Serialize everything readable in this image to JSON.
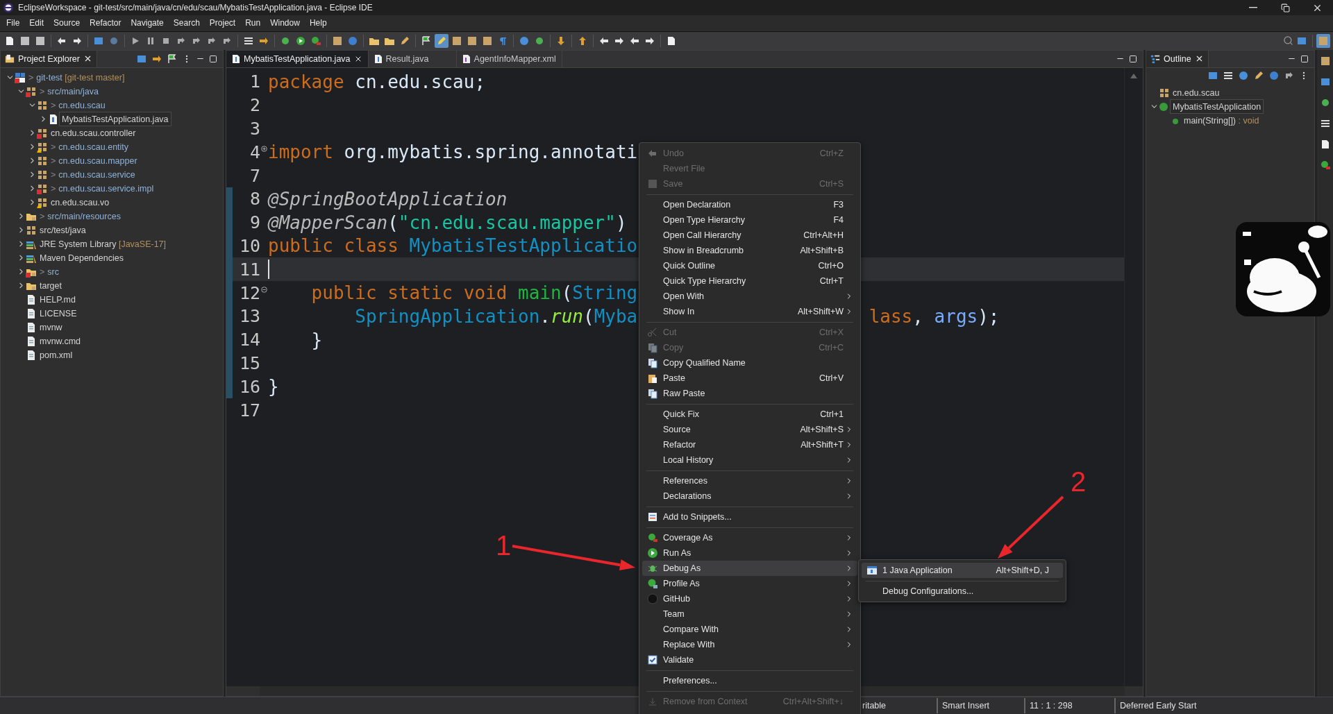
{
  "window": {
    "title": "EclipseWorkspace - git-test/src/main/java/cn/edu/scau/MybatisTestApplication.java - Eclipse IDE"
  },
  "menu_bar": [
    "File",
    "Edit",
    "Source",
    "Refactor",
    "Navigate",
    "Search",
    "Project",
    "Run",
    "Window",
    "Help"
  ],
  "project_explorer": {
    "title": "Project Explorer",
    "tree": [
      {
        "kind": "project",
        "marker": ">",
        "label": "git-test",
        "suffix": "[git-test master]",
        "error": true,
        "expanded": true,
        "selected": false,
        "children": [
          {
            "kind": "source-folder",
            "marker": ">",
            "label": "src/main/java",
            "error": true,
            "expanded": true,
            "selected": false,
            "children": [
              {
                "kind": "package",
                "marker": ">",
                "label": "cn.edu.scau",
                "expanded": true,
                "selected": false,
                "children": [
                  {
                    "kind": "java-file",
                    "label": "MybatisTestApplication.java",
                    "expanded": false,
                    "selected": true
                  }
                ]
              },
              {
                "kind": "package",
                "label": "cn.edu.scau.controller",
                "error": true,
                "expanded": false,
                "selected": false
              },
              {
                "kind": "package",
                "marker": ">",
                "label": "cn.edu.scau.entity",
                "warning": true,
                "expanded": false,
                "selected": false
              },
              {
                "kind": "package",
                "marker": ">",
                "label": "cn.edu.scau.mapper",
                "expanded": false,
                "selected": false
              },
              {
                "kind": "package",
                "marker": ">",
                "label": "cn.edu.scau.service",
                "expanded": false,
                "selected": false
              },
              {
                "kind": "package",
                "marker": ">",
                "label": "cn.edu.scau.service.impl",
                "error": true,
                "expanded": false,
                "selected": false
              },
              {
                "kind": "package",
                "label": "cn.edu.scau.vo",
                "warning": true,
                "expanded": false,
                "selected": false
              }
            ]
          },
          {
            "kind": "resource-folder",
            "marker": ">",
            "label": "src/main/resources",
            "expanded": false,
            "selected": false
          },
          {
            "kind": "source-folder",
            "label": "src/test/java",
            "expanded": false,
            "selected": false
          },
          {
            "kind": "library",
            "label": "JRE System Library",
            "suffix": "[JavaSE-17]",
            "expanded": false,
            "selected": false
          },
          {
            "kind": "library",
            "label": "Maven Dependencies",
            "expanded": false,
            "selected": false
          },
          {
            "kind": "folder",
            "marker": ">",
            "label": "src",
            "error": true,
            "expanded": false,
            "selected": false
          },
          {
            "kind": "folder",
            "label": "target",
            "expanded": false,
            "selected": false
          },
          {
            "kind": "file",
            "label": "HELP.md",
            "selected": false
          },
          {
            "kind": "file",
            "label": "LICENSE",
            "selected": false
          },
          {
            "kind": "file",
            "label": "mvnw",
            "selected": false
          },
          {
            "kind": "file",
            "label": "mvnw.cmd",
            "selected": false
          },
          {
            "kind": "file",
            "label": "pom.xml",
            "selected": false
          }
        ]
      }
    ]
  },
  "editor": {
    "tabs": [
      {
        "kind": "java",
        "label": "MybatisTestApplication.java",
        "selected": true
      },
      {
        "kind": "java",
        "label": "Result.java",
        "selected": false
      },
      {
        "kind": "xml",
        "label": "AgentInfoMapper.xml",
        "selected": false
      }
    ],
    "lines": [
      {
        "n": "1",
        "current": false,
        "changed": false,
        "tokens": [
          {
            "kind": "keyword",
            "t": "package"
          },
          {
            "kind": "plain",
            "t": " cn.edu.scau;"
          }
        ]
      },
      {
        "n": "2",
        "current": false,
        "changed": false
      },
      {
        "n": "3",
        "current": false,
        "changed": false
      },
      {
        "n": "4",
        "current": false,
        "changed": false,
        "folded": true,
        "tokens": [
          {
            "kind": "keyword",
            "t": "import"
          },
          {
            "kind": "plain",
            "t": " org.mybatis.spring.annotati"
          }
        ]
      },
      {
        "n": "7",
        "current": false,
        "changed": false
      },
      {
        "n": "8",
        "current": false,
        "changed": true,
        "tokens": [
          {
            "kind": "annotation",
            "t": "@SpringBootApplication"
          }
        ]
      },
      {
        "n": "9",
        "current": false,
        "changed": true,
        "tokens": [
          {
            "kind": "annotation",
            "t": "@MapperScan"
          },
          {
            "kind": "plain",
            "t": "("
          },
          {
            "kind": "string",
            "t": "\"cn.edu.scau.mapper\""
          },
          {
            "kind": "plain",
            "t": ")"
          }
        ]
      },
      {
        "n": "10",
        "current": false,
        "changed": true,
        "tokens": [
          {
            "kind": "keyword",
            "t": "public class "
          },
          {
            "kind": "type",
            "t": "MybatisTestApplicatio"
          }
        ]
      },
      {
        "n": "11",
        "current": true,
        "changed": true
      },
      {
        "n": "12",
        "current": false,
        "changed": true,
        "folded": false,
        "tokens": [
          {
            "kind": "keyword",
            "t": "    public static void "
          },
          {
            "kind": "method",
            "t": "main"
          },
          {
            "kind": "plain",
            "t": "("
          },
          {
            "kind": "type",
            "t": "String"
          }
        ]
      },
      {
        "n": "13",
        "current": false,
        "changed": true,
        "tokens": [
          {
            "kind": "type",
            "t": "        SpringApplication"
          },
          {
            "kind": "plain",
            "t": "."
          },
          {
            "kind": "static-method",
            "t": "run"
          },
          {
            "kind": "plain",
            "t": "("
          },
          {
            "kind": "type",
            "t": "Myba"
          }
        ],
        "tail": [
          {
            "kind": "keyword",
            "t": "lass"
          },
          {
            "kind": "plain",
            "t": ", "
          },
          {
            "kind": "parameter",
            "t": "args"
          },
          {
            "kind": "plain",
            "t": ");"
          }
        ]
      },
      {
        "n": "14",
        "current": false,
        "changed": true,
        "tokens": [
          {
            "kind": "plain",
            "t": "    }"
          }
        ]
      },
      {
        "n": "15",
        "current": false,
        "changed": true
      },
      {
        "n": "16",
        "current": false,
        "changed": true,
        "tokens": [
          {
            "kind": "plain",
            "t": "}"
          }
        ]
      },
      {
        "n": "17",
        "current": false,
        "changed": false
      }
    ]
  },
  "outline": {
    "title": "Outline",
    "tree": [
      {
        "kind": "package",
        "label": "cn.edu.scau",
        "selected": false
      },
      {
        "kind": "class",
        "label": "MybatisTestApplication",
        "expanded": true,
        "selected": true,
        "children": [
          {
            "kind": "method",
            "label": "main(String[])",
            "suffix": " : void",
            "selected": false
          }
        ]
      }
    ]
  },
  "status_bar": [
    "ritable",
    "Smart Insert",
    "11 : 1 : 298",
    "Deferred Early Start"
  ],
  "context_menu": {
    "items": [
      {
        "kind": "item",
        "label": "Undo",
        "shortcut": "Ctrl+Z",
        "disabled": true,
        "submenu": false,
        "selected": false
      },
      {
        "kind": "item",
        "label": "Revert File",
        "disabled": true,
        "submenu": false,
        "selected": false
      },
      {
        "kind": "item",
        "label": "Save",
        "shortcut": "Ctrl+S",
        "disabled": true,
        "submenu": false,
        "selected": false
      },
      {
        "kind": "separator"
      },
      {
        "kind": "item",
        "label": "Open Declaration",
        "shortcut": "F3",
        "disabled": false,
        "submenu": false,
        "selected": false
      },
      {
        "kind": "item",
        "label": "Open Type Hierarchy",
        "shortcut": "F4",
        "disabled": false,
        "submenu": false,
        "selected": false
      },
      {
        "kind": "item",
        "label": "Open Call Hierarchy",
        "shortcut": "Ctrl+Alt+H",
        "disabled": false,
        "submenu": false,
        "selected": false
      },
      {
        "kind": "item",
        "label": "Show in Breadcrumb",
        "shortcut": "Alt+Shift+B",
        "disabled": false,
        "submenu": false,
        "selected": false
      },
      {
        "kind": "item",
        "label": "Quick Outline",
        "shortcut": "Ctrl+O",
        "disabled": false,
        "submenu": false,
        "selected": false
      },
      {
        "kind": "item",
        "label": "Quick Type Hierarchy",
        "shortcut": "Ctrl+T",
        "disabled": false,
        "submenu": false,
        "selected": false
      },
      {
        "kind": "item",
        "label": "Open With",
        "disabled": false,
        "submenu": true,
        "selected": false
      },
      {
        "kind": "item",
        "label": "Show In",
        "shortcut": "Alt+Shift+W",
        "disabled": false,
        "submenu": true,
        "selected": false
      },
      {
        "kind": "separator"
      },
      {
        "kind": "item",
        "label": "Cut",
        "shortcut": "Ctrl+X",
        "disabled": true,
        "submenu": false,
        "selected": false
      },
      {
        "kind": "item",
        "label": "Copy",
        "shortcut": "Ctrl+C",
        "disabled": true,
        "submenu": false,
        "selected": false
      },
      {
        "kind": "item",
        "label": "Copy Qualified Name",
        "disabled": false,
        "submenu": false,
        "selected": false
      },
      {
        "kind": "item",
        "label": "Paste",
        "shortcut": "Ctrl+V",
        "disabled": false,
        "submenu": false,
        "selected": false
      },
      {
        "kind": "item",
        "label": "Raw Paste",
        "disabled": false,
        "submenu": false,
        "selected": false
      },
      {
        "kind": "separator"
      },
      {
        "kind": "item",
        "label": "Quick Fix",
        "shortcut": "Ctrl+1",
        "disabled": false,
        "submenu": false,
        "selected": false
      },
      {
        "kind": "item",
        "label": "Source",
        "shortcut": "Alt+Shift+S",
        "disabled": false,
        "submenu": true,
        "selected": false
      },
      {
        "kind": "item",
        "label": "Refactor",
        "shortcut": "Alt+Shift+T",
        "disabled": false,
        "submenu": true,
        "selected": false
      },
      {
        "kind": "item",
        "label": "Local History",
        "disabled": false,
        "submenu": true,
        "selected": false
      },
      {
        "kind": "separator"
      },
      {
        "kind": "item",
        "label": "References",
        "disabled": false,
        "submenu": true,
        "selected": false
      },
      {
        "kind": "item",
        "label": "Declarations",
        "disabled": false,
        "submenu": true,
        "selected": false
      },
      {
        "kind": "separator"
      },
      {
        "kind": "item",
        "label": "Add to Snippets...",
        "disabled": false,
        "submenu": false,
        "selected": false
      },
      {
        "kind": "separator"
      },
      {
        "kind": "item",
        "label": "Coverage As",
        "disabled": false,
        "submenu": true,
        "selected": false
      },
      {
        "kind": "item",
        "label": "Run As",
        "disabled": false,
        "submenu": true,
        "selected": false
      },
      {
        "kind": "item",
        "label": "Debug As",
        "disabled": false,
        "submenu": true,
        "selected": true
      },
      {
        "kind": "item",
        "label": "Profile As",
        "disabled": false,
        "submenu": true,
        "selected": false
      },
      {
        "kind": "item",
        "label": "GitHub",
        "disabled": false,
        "submenu": true,
        "selected": false
      },
      {
        "kind": "item",
        "label": "Team",
        "disabled": false,
        "submenu": true,
        "selected": false
      },
      {
        "kind": "item",
        "label": "Compare With",
        "disabled": false,
        "submenu": true,
        "selected": false
      },
      {
        "kind": "item",
        "label": "Replace With",
        "disabled": false,
        "submenu": true,
        "selected": false
      },
      {
        "kind": "item",
        "label": "Validate",
        "disabled": false,
        "submenu": false,
        "selected": false
      },
      {
        "kind": "separator"
      },
      {
        "kind": "item",
        "label": "Preferences...",
        "disabled": false,
        "submenu": false,
        "selected": false
      },
      {
        "kind": "separator"
      },
      {
        "kind": "item",
        "label": "Remove from Context",
        "shortcut": "Ctrl+Alt+Shift+↓",
        "disabled": true,
        "submenu": false,
        "selected": false
      }
    ]
  },
  "submenu": {
    "items": [
      {
        "kind": "item",
        "label": "1 Java Application",
        "shortcut": "Alt+Shift+D, J",
        "selected": true
      },
      {
        "kind": "separator"
      },
      {
        "kind": "item",
        "label": "Debug Configurations...",
        "selected": false
      }
    ]
  },
  "annotations": [
    {
      "label": "1"
    },
    {
      "label": "2"
    }
  ],
  "sticker": {
    "kind": "picture"
  }
}
